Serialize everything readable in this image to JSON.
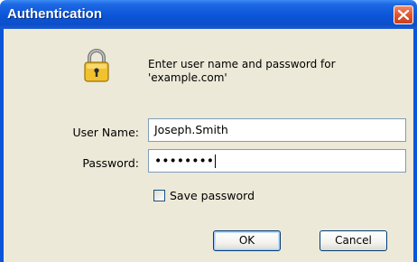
{
  "window": {
    "title": "Authentication"
  },
  "dialog": {
    "prompt_line1": "Enter user name and password for",
    "prompt_line2": "'example.com'",
    "username_label": "User Name:",
    "username_value": "Joseph.Smith",
    "password_label": "Password:",
    "password_value": "••••••••",
    "save_password_label": "Save password",
    "save_password_checked": false,
    "ok_label": "OK",
    "cancel_label": "Cancel"
  },
  "icons": {
    "lock": "lock-icon",
    "close": "close-icon"
  },
  "colors": {
    "titlebar": "#0a55d8",
    "close_button": "#e0552f",
    "dialog_background": "#ece9d8",
    "field_border": "#7f9db9"
  }
}
